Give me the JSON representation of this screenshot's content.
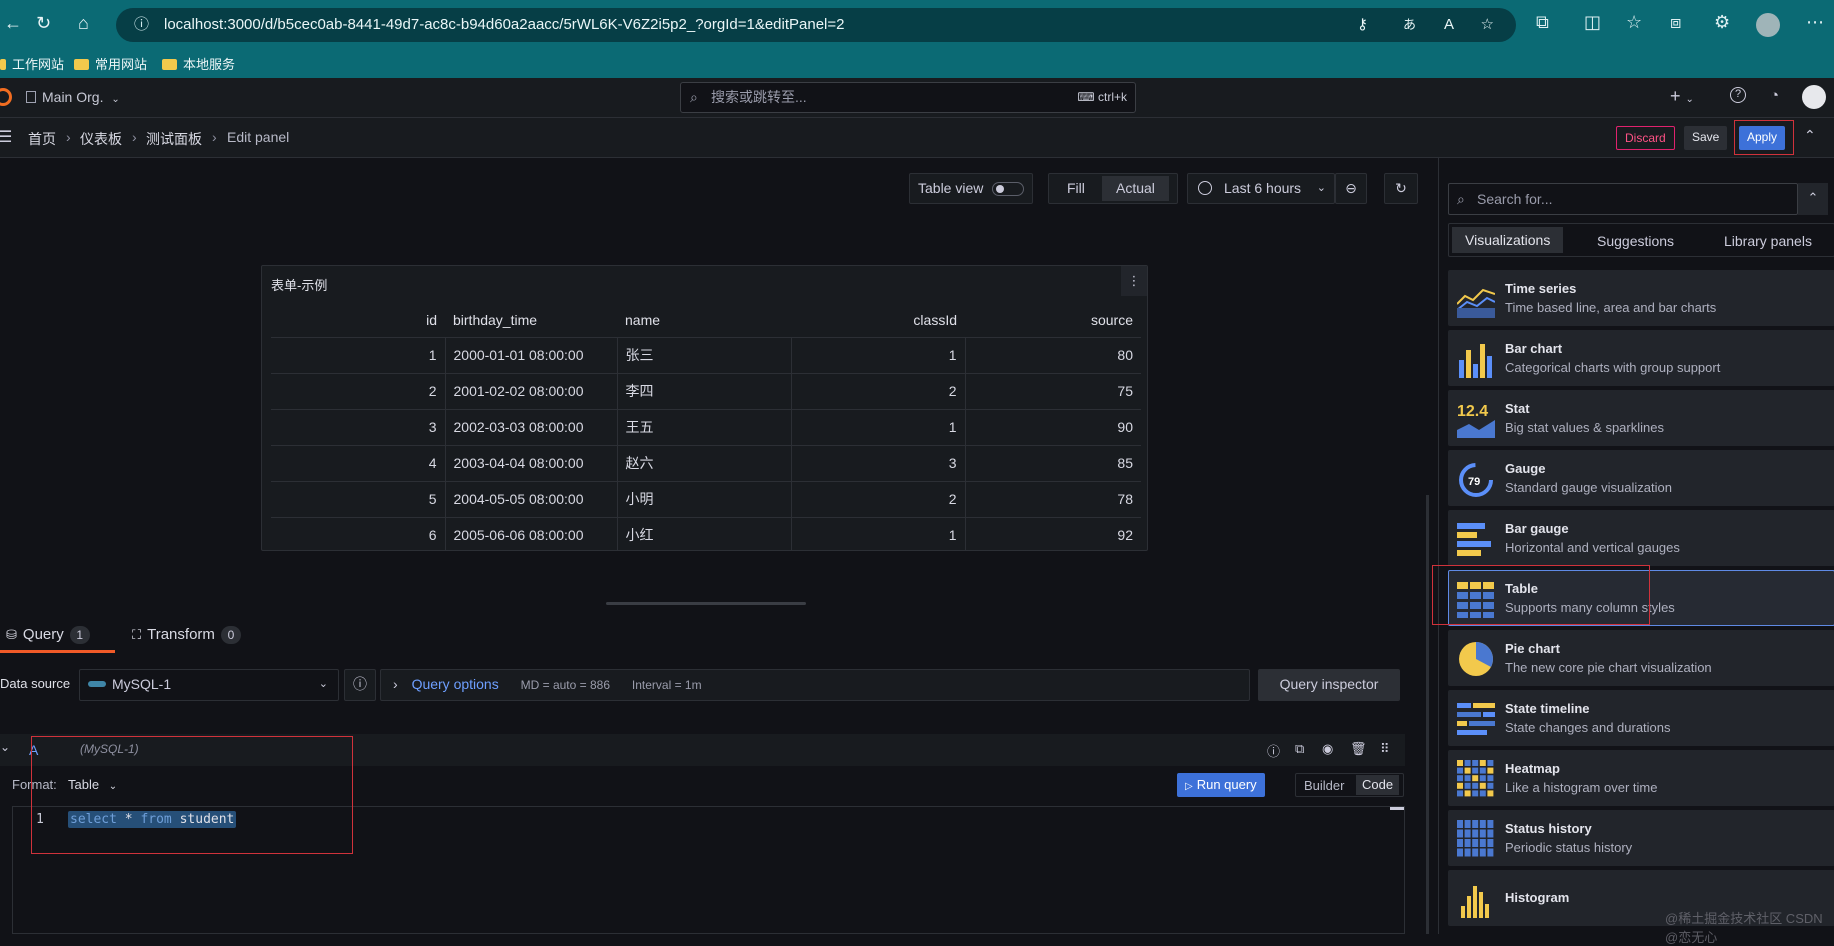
{
  "browser": {
    "url": "localhost:3000/d/b5cec0ab-8441-49d7-ac8c-b94d60a2aacc/5rWL6K-V6Z2i5p2_?orgId=1&editPanel=2",
    "bookmarks": [
      "工作网站",
      "常用网站",
      "本地服务"
    ]
  },
  "topbar": {
    "org": "Main Org.",
    "search_placeholder": "搜索或跳转至...",
    "search_shortcut": "ctrl+k"
  },
  "breadcrumb": [
    "首页",
    "仪表板",
    "测试面板",
    "Edit panel"
  ],
  "toolbar": {
    "discard": "Discard",
    "save": "Save",
    "apply": "Apply"
  },
  "panel_controls": {
    "table_view": "Table view",
    "fill": "Fill",
    "actual": "Actual",
    "time_range": "Last 6 hours"
  },
  "panel": {
    "title": "表单-示例",
    "columns": [
      "id",
      "birthday_time",
      "name",
      "classId",
      "source"
    ],
    "rows": [
      [
        "1",
        "2000-01-01 08:00:00",
        "张三",
        "1",
        "80"
      ],
      [
        "2",
        "2001-02-02 08:00:00",
        "李四",
        "2",
        "75"
      ],
      [
        "3",
        "2002-03-03 08:00:00",
        "王五",
        "1",
        "90"
      ],
      [
        "4",
        "2003-04-04 08:00:00",
        "赵六",
        "3",
        "85"
      ],
      [
        "5",
        "2004-05-05 08:00:00",
        "小明",
        "2",
        "78"
      ],
      [
        "6",
        "2005-06-06 08:00:00",
        "小红",
        "1",
        "92"
      ]
    ]
  },
  "query": {
    "tab_query": "Query",
    "tab_query_count": "1",
    "tab_transform": "Transform",
    "tab_transform_count": "0",
    "datasource_label": "Data source",
    "datasource": "MySQL-1",
    "query_options": "Query options",
    "md": "MD = auto = 886",
    "interval": "Interval = 1m",
    "inspector": "Query inspector",
    "ref_id": "A",
    "ref_ds": "(MySQL-1)",
    "format_label": "Format:",
    "format_value": "Table",
    "run": "Run query",
    "builder": "Builder",
    "code": "Code",
    "line_no": "1",
    "sql_kw1": "select",
    "sql_star": "*",
    "sql_kw2": "from",
    "sql_table": "student"
  },
  "picker": {
    "search_placeholder": "Search for...",
    "tabs": [
      "Visualizations",
      "Suggestions",
      "Library panels"
    ],
    "items": [
      {
        "name": "Time series",
        "desc": "Time based line, area and bar charts"
      },
      {
        "name": "Bar chart",
        "desc": "Categorical charts with group support"
      },
      {
        "name": "Stat",
        "desc": "Big stat values & sparklines"
      },
      {
        "name": "Gauge",
        "desc": "Standard gauge visualization"
      },
      {
        "name": "Bar gauge",
        "desc": "Horizontal and vertical gauges"
      },
      {
        "name": "Table",
        "desc": "Supports many column styles"
      },
      {
        "name": "Pie chart",
        "desc": "The new core pie chart visualization"
      },
      {
        "name": "State timeline",
        "desc": "State changes and durations"
      },
      {
        "name": "Heatmap",
        "desc": "Like a histogram over time"
      },
      {
        "name": "Status history",
        "desc": "Periodic status history"
      },
      {
        "name": "Histogram",
        "desc": ""
      }
    ],
    "stat_icon_text": "12.4",
    "gauge_icon_text": "79"
  },
  "watermark": "@稀土掘金技术社区 CSDN @恋无心"
}
